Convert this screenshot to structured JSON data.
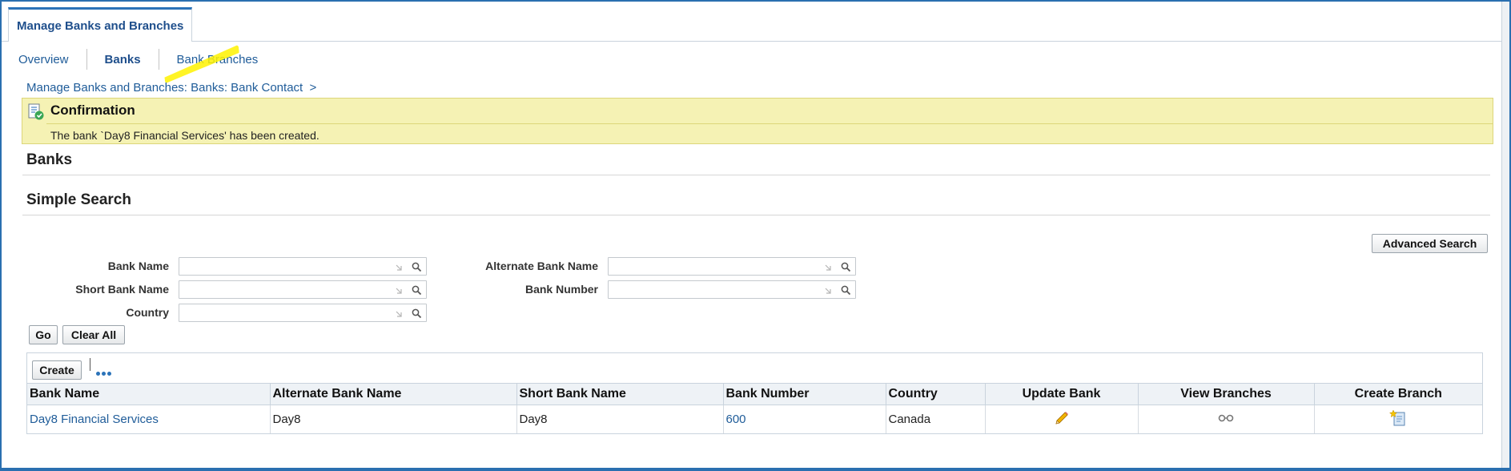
{
  "top_tab": {
    "label": "Manage Banks and Branches"
  },
  "subtabs": [
    {
      "label": "Overview"
    },
    {
      "label": "Banks"
    },
    {
      "label": "Bank Branches"
    }
  ],
  "breadcrumb": {
    "text": "Manage Banks and Branches: Banks: Bank Contact  >"
  },
  "confirmation": {
    "title": "Confirmation",
    "message": "The bank `Day8 Financial Services' has been created."
  },
  "page_title": "Banks",
  "search": {
    "title": "Simple Search",
    "advanced_label": "Advanced Search",
    "fields": {
      "bank_name": {
        "label": "Bank Name",
        "value": ""
      },
      "short_bank_name": {
        "label": "Short Bank Name",
        "value": ""
      },
      "country": {
        "label": "Country",
        "value": ""
      },
      "alternate_bank_name": {
        "label": "Alternate Bank Name",
        "value": ""
      },
      "bank_number": {
        "label": "Bank Number",
        "value": ""
      }
    },
    "go_label": "Go",
    "clear_label": "Clear All"
  },
  "results": {
    "create_label": "Create",
    "columns": {
      "bank_name": "Bank Name",
      "alternate_bank_name": "Alternate Bank Name",
      "short_bank_name": "Short Bank Name",
      "bank_number": "Bank Number",
      "country": "Country",
      "update_bank": "Update Bank",
      "view_branches": "View Branches",
      "create_branch": "Create Branch"
    },
    "rows": [
      {
        "bank_name": "Day8 Financial Services",
        "alternate_bank_name": "Day8",
        "short_bank_name": "Day8",
        "bank_number": "600",
        "country": "Canada",
        "update_icon": "pencil-icon",
        "view_icon": "glasses-icon",
        "create_branch_icon": "create-document-icon"
      }
    ]
  },
  "colors": {
    "link": "#1f5c99",
    "confirmation_bg": "#f5f2b4",
    "highlight": "#fff200",
    "tab_accent": "#2b73b9"
  }
}
